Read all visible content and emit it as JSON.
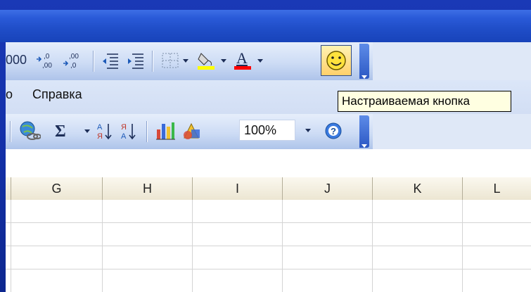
{
  "toolbar_formatting": {
    "partial_number_text": "000",
    "buttons": [
      "increase-decimal-icon",
      "decrease-decimal-icon",
      "decrease-indent-icon",
      "increase-indent-icon",
      "borders-icon",
      "fill-color-icon",
      "font-color-icon",
      "smiley-icon"
    ],
    "fill_color": "#ffff00",
    "font_color": "#ff0000"
  },
  "menubar": {
    "items": [
      {
        "label": "о"
      },
      {
        "label": "Справка"
      }
    ]
  },
  "tooltip": {
    "text": "Настраиваемая кнопка"
  },
  "toolbar_standard": {
    "buttons": [
      "hyperlink-icon",
      "autosum-icon",
      "sort-ascending-icon",
      "sort-descending-icon",
      "chart-wizard-icon",
      "drawing-icon",
      "help-icon"
    ],
    "zoom_value": "100%"
  },
  "spreadsheet": {
    "column_headers": [
      "G",
      "H",
      "I",
      "J",
      "K",
      "L"
    ]
  },
  "colors": {
    "desktop_blue": "#1a2f9a",
    "toolbar_blue": "#cddcf5",
    "tooltip_bg": "#ffffe1"
  }
}
